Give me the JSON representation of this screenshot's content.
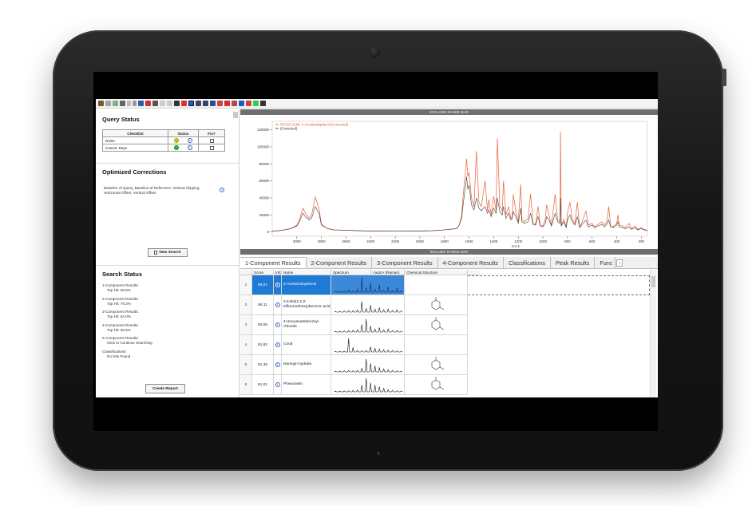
{
  "left_panel": {
    "query_status_title": "Query Status",
    "checklist_headers": [
      "Checklist",
      "Status",
      "Fix?"
    ],
    "checklist_rows": [
      {
        "label": "Noise",
        "status_color": "#f2d20f",
        "status_glyph": "?"
      },
      {
        "label": "Cosmic Rays",
        "status_color": "#2fbf2f",
        "status_glyph": ""
      }
    ],
    "optimized_title": "Optimized Corrections",
    "optimized_text": "Baseline of Query, Baseline of Reference, Vertical Clipping, Horizontal Offset, Vertical Offset",
    "new_search_label": "New Search",
    "search_status_title": "Search Status",
    "search_status_items": [
      {
        "label": "1-Component Results:",
        "value": "Top Hit: 68.6%"
      },
      {
        "label": "2-Component Results:",
        "value": "Top Hit: 79.2%"
      },
      {
        "label": "3-Component Results:",
        "value": "Top Hit: 84.0%"
      },
      {
        "label": "4-Component Results:",
        "value": "Top Hit: 85.5%"
      },
      {
        "label": "5-Component Results:",
        "value": "Click to Continue Searching"
      },
      {
        "label": "Classifications:",
        "value": "No Hits Found"
      }
    ],
    "create_report_label": "Create Report"
  },
  "chart": {
    "exclude_bar": "EXCLUDE RANGE BAR",
    "include_bar": "INCLUDE RANGE BAR",
    "xlabel": "cm-1",
    "legend": [
      "RSTSS #158: 4-Acetamidophenol (Corrected)",
      "(Corrected)"
    ],
    "colors": {
      "reference": "#e8562a",
      "query": "#2a2a2a"
    }
  },
  "chart_data": {
    "type": "line",
    "title": "",
    "xlabel": "cm-1",
    "ylabel": "",
    "xlim": [
      3200,
      150
    ],
    "ylim": [
      -5000,
      130000
    ],
    "x_ticks": [
      3000,
      2800,
      2600,
      2400,
      2200,
      2000,
      1800,
      1600,
      1400,
      1200,
      1000,
      800,
      600,
      400,
      200
    ],
    "y_ticks": [
      0,
      20000,
      40000,
      60000,
      80000,
      100000,
      120000
    ],
    "x_tick_labels": [
      "3000",
      "2800",
      "2600",
      "2400",
      "2200",
      "2000",
      "1800",
      "1600",
      "1400",
      "1200",
      "1000",
      "800",
      "600",
      "400",
      "200"
    ],
    "y_tick_labels": [
      "0",
      "20000",
      "40000",
      "60000",
      "80000",
      "100000",
      "120000"
    ],
    "series": [
      {
        "name": "RSTSS #158: 4-Acetamidophenol (Corrected)",
        "x": [
          3200,
          3150,
          3100,
          3050,
          3000,
          2980,
          2950,
          2930,
          2900,
          2880,
          2850,
          2820,
          2800,
          2750,
          2700,
          2600,
          2500,
          2400,
          2300,
          2200,
          2100,
          2000,
          1900,
          1800,
          1700,
          1680,
          1660,
          1650,
          1620,
          1610,
          1600,
          1580,
          1560,
          1540,
          1520,
          1500,
          1470,
          1450,
          1440,
          1420,
          1400,
          1380,
          1370,
          1350,
          1330,
          1320,
          1300,
          1280,
          1260,
          1250,
          1240,
          1220,
          1200,
          1180,
          1170,
          1150,
          1120,
          1100,
          1080,
          1060,
          1040,
          1020,
          1000,
          980,
          970,
          950,
          930,
          900,
          880,
          860,
          857,
          850,
          830,
          810,
          800,
          780,
          760,
          740,
          720,
          700,
          680,
          650,
          630,
          600,
          580,
          520,
          500,
          480,
          465,
          450,
          430,
          400,
          390,
          380,
          350,
          330,
          300,
          280,
          250,
          230,
          200,
          180,
          150
        ],
        "y": [
          1000,
          1500,
          2500,
          4000,
          8000,
          14000,
          28000,
          22000,
          16000,
          20000,
          41000,
          28000,
          9000,
          4000,
          2500,
          2000,
          1500,
          1200,
          1000,
          900,
          1000,
          1200,
          1500,
          2500,
          4000,
          8000,
          20000,
          40000,
          86000,
          65000,
          70000,
          40000,
          30000,
          95000,
          35000,
          30000,
          60000,
          25000,
          38000,
          20000,
          42000,
          25000,
          110000,
          30000,
          25000,
          60000,
          20000,
          30000,
          16000,
          18000,
          44000,
          25000,
          12000,
          56000,
          15000,
          12000,
          16000,
          45000,
          10000,
          9000,
          30000,
          8000,
          7000,
          15000,
          32000,
          20000,
          8000,
          44000,
          15000,
          12000,
          118000,
          8000,
          15000,
          6000,
          22000,
          35000,
          15000,
          10000,
          35000,
          5000,
          12000,
          25000,
          8000,
          10000,
          6000,
          12000,
          8000,
          12000,
          30000,
          8000,
          6000,
          10000,
          20000,
          8000,
          7000,
          5000,
          10000,
          4000,
          7000,
          3000,
          5000,
          3000,
          2000
        ]
      },
      {
        "name": "(Corrected)",
        "x": [
          3200,
          3150,
          3100,
          3050,
          3000,
          2980,
          2950,
          2930,
          2900,
          2880,
          2850,
          2820,
          2800,
          2750,
          2700,
          2600,
          2500,
          2400,
          2300,
          2200,
          2100,
          2000,
          1900,
          1800,
          1700,
          1680,
          1660,
          1650,
          1620,
          1610,
          1600,
          1580,
          1560,
          1540,
          1520,
          1500,
          1470,
          1450,
          1440,
          1420,
          1400,
          1380,
          1370,
          1350,
          1330,
          1320,
          1300,
          1280,
          1260,
          1250,
          1240,
          1220,
          1200,
          1180,
          1170,
          1150,
          1120,
          1100,
          1080,
          1060,
          1040,
          1020,
          1000,
          980,
          970,
          950,
          930,
          900,
          880,
          860,
          857,
          850,
          830,
          810,
          800,
          780,
          760,
          740,
          720,
          700,
          680,
          650,
          630,
          600,
          580,
          520,
          500,
          480,
          465,
          450,
          430,
          400,
          390,
          380,
          350,
          330,
          300,
          280,
          250,
          230,
          200,
          180,
          150
        ],
        "y": [
          1000,
          1500,
          2500,
          4000,
          7000,
          12000,
          22000,
          18000,
          14000,
          16000,
          30000,
          22000,
          8000,
          4000,
          2500,
          2000,
          1500,
          1200,
          1000,
          900,
          1000,
          1200,
          1500,
          2500,
          4000,
          8000,
          16000,
          30000,
          65000,
          50000,
          55000,
          32000,
          26000,
          40000,
          28000,
          25000,
          30000,
          22000,
          26000,
          18000,
          28000,
          22000,
          40000,
          24000,
          20000,
          30000,
          16000,
          22000,
          14000,
          15000,
          24000,
          18000,
          10000,
          28000,
          12000,
          10000,
          12000,
          22000,
          9000,
          8000,
          18000,
          7000,
          6000,
          10000,
          18000,
          14000,
          7000,
          22000,
          12000,
          10000,
          40000,
          7000,
          12000,
          5000,
          14000,
          20000,
          12000,
          8000,
          18000,
          5000,
          9000,
          14000,
          6000,
          8000,
          5000,
          9000,
          6000,
          9000,
          14000,
          6000,
          5000,
          8000,
          12000,
          6000,
          5000,
          4000,
          6000,
          3000,
          5000,
          2500,
          4000,
          2500,
          1500
        ]
      }
    ]
  },
  "tabs": [
    "1-Component Results",
    "2-Component Results",
    "3-Component Results",
    "4-Component Results",
    "Classifications",
    "Peak Results",
    "Func"
  ],
  "grid": {
    "headers": [
      "Score",
      "Info",
      "Name",
      "Spectrum",
      "<auto> (Raman)",
      "Chemical Structure"
    ],
    "rows": [
      {
        "idx": "1",
        "score": "68.61",
        "name": "4-Acetamidophenol",
        "selected": true
      },
      {
        "idx": "2",
        "score": "66.11",
        "name": "2,5-Bis(2,2,2-trifluoroethoxy)benzoic acid",
        "selected": false
      },
      {
        "idx": "3",
        "score": "63.06",
        "name": "4-Isocyanatobenzoyl chloride",
        "selected": false
      },
      {
        "idx": "4",
        "score": "61.82",
        "name": "Coral",
        "selected": false
      },
      {
        "idx": "5",
        "score": "61.35",
        "name": "Naringin hydrate",
        "selected": false
      },
      {
        "idx": "6",
        "score": "61.01",
        "name": "Phenacetin",
        "selected": false
      }
    ]
  }
}
